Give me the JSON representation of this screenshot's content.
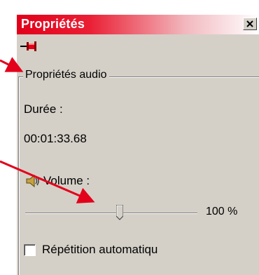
{
  "window": {
    "title": "Propriétés",
    "close_icon": "close-icon",
    "pin_icon": "pushpin-icon"
  },
  "audio": {
    "group_title": "Propriétés audio",
    "duration_label": "Durée :",
    "duration_value": "00:01:33.68",
    "volume_label": "Volume :",
    "volume_icon": "speaker-icon",
    "volume_percent": 100,
    "volume_text": "100 %",
    "slider_position": 0.55,
    "repeat_label": "Répétition automatiqu",
    "repeat_checked": false
  },
  "colors": {
    "title_bar": "#e2001a",
    "panel": "#d4d0c8",
    "annotation_arrow": "#e3001b"
  }
}
